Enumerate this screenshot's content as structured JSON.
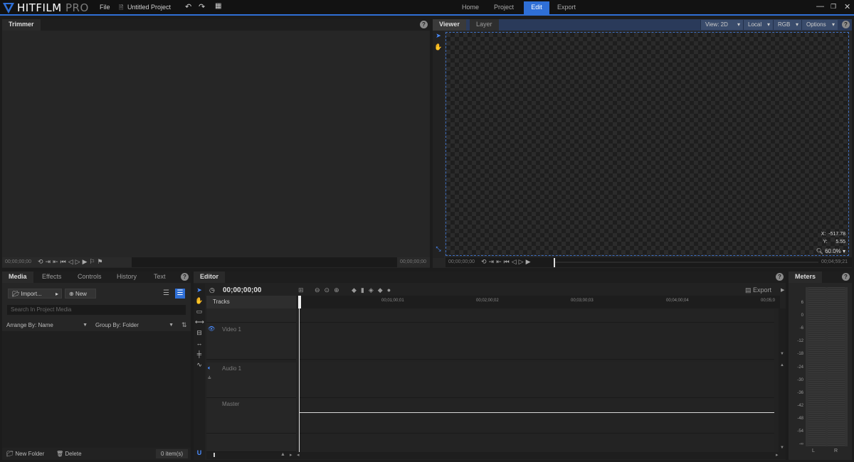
{
  "app": {
    "logo_main": "HITFILM",
    "logo_sub": " PRO",
    "menu_file": "File",
    "project_name": "Untitled Project"
  },
  "nav": {
    "home": "Home",
    "project": "Project",
    "edit": "Edit",
    "export": "Export"
  },
  "window_controls": {
    "minimize": "—",
    "restore": "❐",
    "close": "✕"
  },
  "trimmer": {
    "title": "Trimmer",
    "timecode_start": "00;00;00;00",
    "timecode_end": "00;00;00;00"
  },
  "viewer": {
    "tabs": [
      "Viewer",
      "Layer"
    ],
    "view_mode": "View: 2D",
    "space": "Local",
    "channel": "RGB",
    "options": "Options",
    "coord_x_label": "X:",
    "coord_x": "-517.78",
    "coord_y_label": "Y:",
    "coord_y": "5.55",
    "zoom": "60.0%",
    "timecode_start": "00;00;00;00",
    "timecode_end": "00;04;59;21"
  },
  "media": {
    "tabs": [
      "Media",
      "Effects",
      "Controls",
      "History",
      "Text"
    ],
    "import_label": "Import...",
    "new_label": "New",
    "search_placeholder": "Search In Project Media",
    "arrange_by": "Arrange By: Name",
    "group_by": "Group By: Folder",
    "new_folder": "New Folder",
    "delete": "Delete",
    "item_count": "0 item(s)"
  },
  "editor": {
    "title": "Editor",
    "timecode": "00;00;00;00",
    "export_label": "Export",
    "tracks_label": "Tracks",
    "video_track": "Video 1",
    "audio_track": "Audio 1",
    "master_track": "Master",
    "ruler_marks": [
      "00;01;00;01",
      "00;02;00;02",
      "00;03;00;03",
      "00;04;00;04",
      "00;05;0"
    ]
  },
  "meters": {
    "title": "Meters",
    "scale": [
      "6",
      "0",
      "-6",
      "-12",
      "-18",
      "-24",
      "-30",
      "-36",
      "-42",
      "-48",
      "-54",
      "-∞"
    ],
    "left_label": "L",
    "right_label": "R"
  },
  "colors": {
    "accent": "#2f6fd6",
    "panel_bg": "#262626",
    "title_bg": "#121212"
  }
}
